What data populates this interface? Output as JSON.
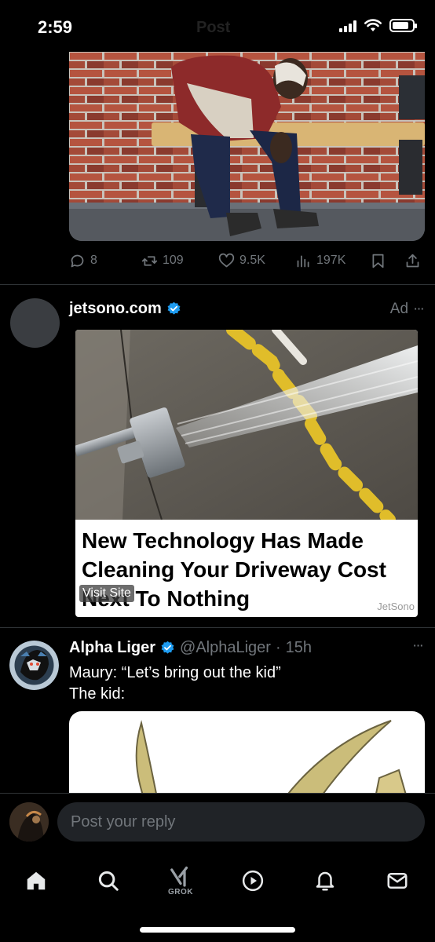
{
  "status_bar": {
    "time": "2:59",
    "header_ghost": "Post"
  },
  "post1": {
    "image_alt": "Worker sitting on bench",
    "actions": {
      "replies": "8",
      "reposts": "109",
      "likes": "9.5K",
      "views": "197K"
    }
  },
  "ad": {
    "advertiser": "jetsono.com",
    "label": "Ad",
    "more": "···",
    "headline": "New Technology Has Made Cleaning Your Driveway Cost Next To Nothing",
    "visit_site": "Visit Site",
    "brand": "JetSono"
  },
  "post2": {
    "name": "Alpha Liger",
    "handle": "@AlphaLiger",
    "separator": "·",
    "time": "15h",
    "more": "···",
    "line1": "Maury: “Let’s bring out the kid”",
    "line2": "The kid:"
  },
  "reply": {
    "placeholder": "Post your reply"
  },
  "tabs": {
    "grok_label": "GROK"
  },
  "colors": {
    "background": "#000000",
    "verified": "#1d9bf0",
    "muted": "#71767b",
    "input_bg": "#202327"
  },
  "icons": [
    "reply-icon",
    "repost-icon",
    "like-icon",
    "views-icon",
    "bookmark-icon",
    "share-icon",
    "verified-icon",
    "home-icon",
    "search-icon",
    "grok-icon",
    "video-icon",
    "notifications-icon",
    "messages-icon"
  ]
}
